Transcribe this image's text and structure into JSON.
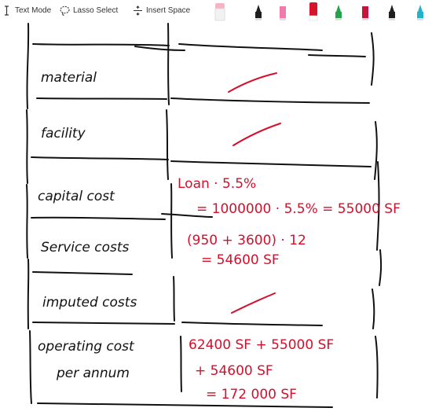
{
  "toolbar": {
    "text_mode_label": "Text Mode",
    "lasso_select_label": "Lasso Select",
    "insert_space_label": "Insert Space",
    "pens": [
      {
        "icon": "eraser-icon",
        "color": "#f4b6c4"
      },
      {
        "icon": "pen-icon",
        "color": "#1e1e1e"
      },
      {
        "icon": "pen-icon",
        "color": "#f07aa8"
      },
      {
        "icon": "pen-icon",
        "color": "#d8142c"
      },
      {
        "icon": "pen-icon",
        "color": "#26a34a"
      },
      {
        "icon": "pen-icon",
        "color": "#c7143c"
      },
      {
        "icon": "pen-icon",
        "color": "#1e1e1e"
      },
      {
        "icon": "pen-icon",
        "color": "#23b3c7"
      }
    ]
  },
  "ink_colors": {
    "black": "#111111",
    "red": "#d50f2b"
  },
  "table": {
    "rows": [
      {
        "label": "material",
        "value_lines": [
          "/"
        ]
      },
      {
        "label": "facility",
        "value_lines": [
          "/"
        ]
      },
      {
        "label": "capital cost",
        "value_lines": [
          "Loan · 5.5%",
          "= 1000000 · 5.5% = 55000 SF"
        ]
      },
      {
        "label": "Service costs",
        "value_lines": [
          "(950 + 3600) · 12",
          "= 54600 SF"
        ]
      },
      {
        "label": "imputed costs",
        "value_lines": [
          "/"
        ]
      },
      {
        "label": "operating cost",
        "label2": "per annum",
        "value_lines": [
          "62400 SF + 55000 SF",
          "+ 54600 SF",
          "= 172 000 SF"
        ]
      }
    ]
  }
}
